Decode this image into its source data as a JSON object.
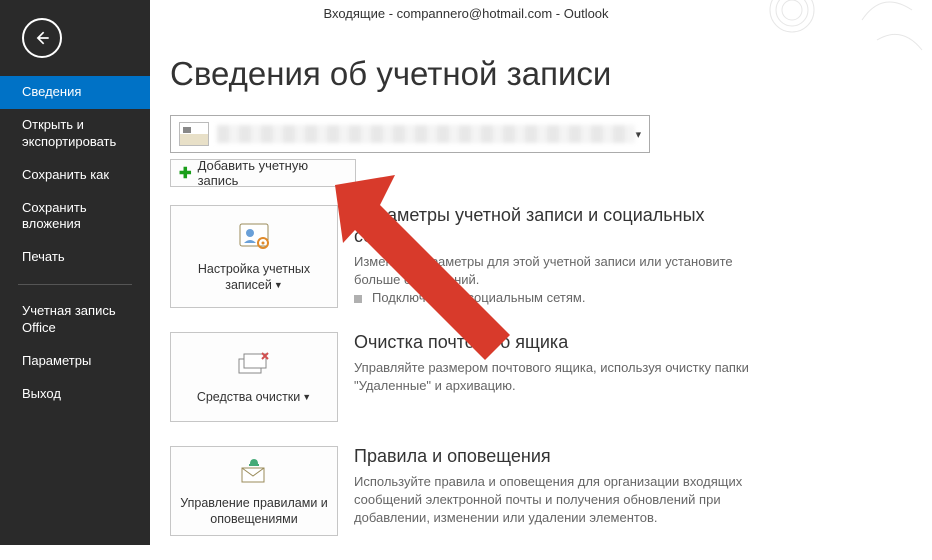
{
  "window_title": "Входящие - compannero@hotmail.com - Outlook",
  "sidebar": {
    "items": [
      {
        "label": "Сведения",
        "active": true
      },
      {
        "label": "Открыть и экспортировать"
      },
      {
        "label": "Сохранить как"
      },
      {
        "label": "Сохранить вложения"
      },
      {
        "label": "Печать"
      }
    ],
    "items2": [
      {
        "label": "Учетная запись Office"
      },
      {
        "label": "Параметры"
      },
      {
        "label": "Выход"
      }
    ]
  },
  "page_title": "Сведения об учетной записи",
  "add_account_label": "Добавить учетную запись",
  "tiles": [
    {
      "button_label": "Настройка учетных записей",
      "has_dropdown": true,
      "title": "Параметры учетной записи и социальных сетей",
      "desc": "Измените параметры для этой учетной записи или установите больше соединений.",
      "sub": "Подключение к социальным сетям."
    },
    {
      "button_label": "Средства очистки",
      "has_dropdown": true,
      "title": "Очистка почтового ящика",
      "desc": "Управляйте размером почтового ящика, используя очистку папки \"Удаленные\" и архивацию."
    },
    {
      "button_label": "Управление правилами и оповещениями",
      "has_dropdown": false,
      "title": "Правила и оповещения",
      "desc": "Используйте правила и оповещения для организации входящих сообщений электронной почты и получения обновлений при добавлении, изменении или удалении элементов."
    }
  ]
}
